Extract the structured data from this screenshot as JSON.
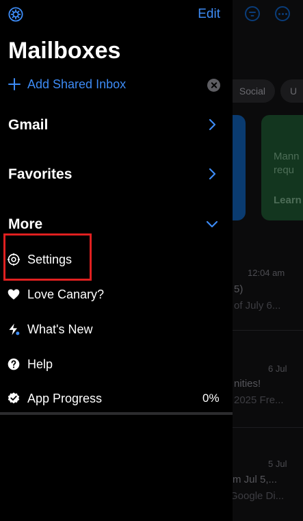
{
  "header": {
    "edit_label": "Edit",
    "title": "Mailboxes"
  },
  "add_inbox": {
    "label": "Add Shared Inbox"
  },
  "sections": [
    {
      "label": "Gmail",
      "state": "collapsed"
    },
    {
      "label": "Favorites",
      "state": "collapsed"
    },
    {
      "label": "More",
      "state": "expanded"
    }
  ],
  "more_items": [
    {
      "label": "Settings",
      "icon": "gear-icon"
    },
    {
      "label": "Love Canary?",
      "icon": "heart-icon"
    },
    {
      "label": "What's New",
      "icon": "bolt-icon"
    },
    {
      "label": "Help",
      "icon": "question-icon"
    },
    {
      "label": "App Progress",
      "icon": "badge-check-icon",
      "value": "0%"
    }
  ],
  "background": {
    "tabs": [
      "Social",
      "U"
    ],
    "card_text": [
      "Mann",
      "requ",
      "Learn"
    ],
    "messages": [
      {
        "time": "12:04 am",
        "line1": "5)",
        "line2": "of July 6..."
      },
      {
        "time": "6 Jul",
        "line1": "nities!",
        "line2": "2025 Fre..."
      },
      {
        "time": "5 Jul",
        "line1": "m Jul 5,...",
        "line2": "Google Di..."
      }
    ]
  },
  "colors": {
    "accent": "#3d8bf5",
    "background": "#000000",
    "highlight": "#e02020"
  }
}
